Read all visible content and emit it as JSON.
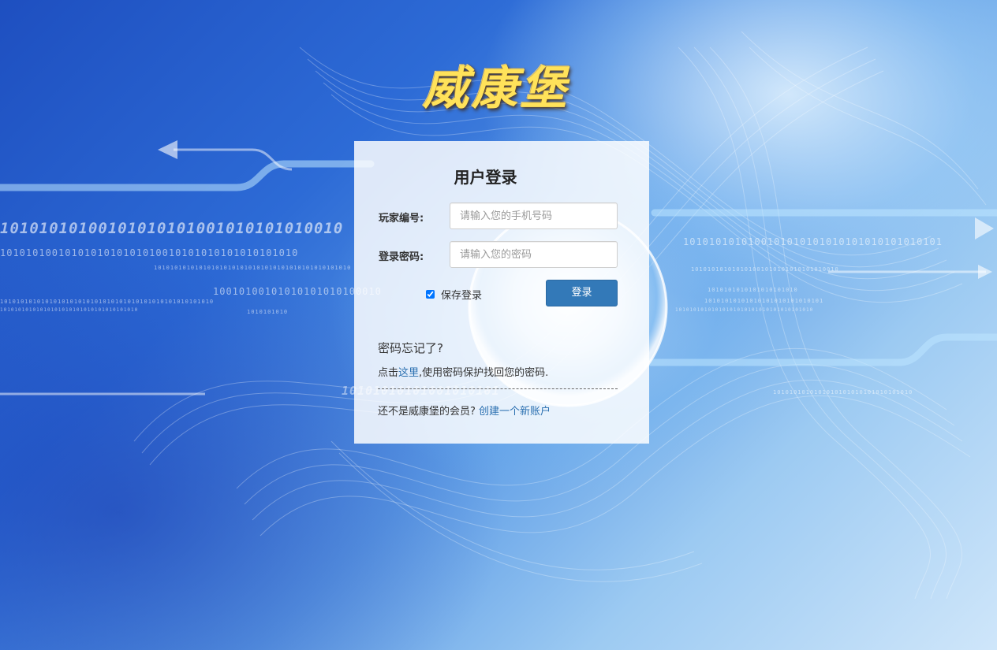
{
  "logo": {
    "text": "威康堡"
  },
  "binary_strings": [
    "10101010100101010101001010101010010",
    "1010101001010101010101010010101010101010101010",
    "101010101010101010101010101010101010101010101010",
    "10010100101010101010100010",
    "1010101010101010101010101010101010101010101010101010",
    "10101010101010101010101010101010101010",
    "1010101010",
    "1010101010100101010101010101010101010101",
    "101010101010101001010101010101010010",
    "1010101010101010101010",
    "10101010101010101010101010101",
    "10101010101010101010101010101010101010",
    "10101010101001010101",
    "1010101010101010101010101010101010"
  ],
  "login": {
    "title": "用户登录",
    "username_label": "玩家编号:",
    "username_placeholder": "请输入您的手机号码",
    "password_label": "登录密码:",
    "password_placeholder": "请输入您的密码",
    "remember_label": "保存登录",
    "remember_checked": true,
    "submit_label": "登录",
    "accent_color": "#3379b8"
  },
  "forgot": {
    "title": "密码忘记了?",
    "prefix": "点击",
    "link": "这里",
    "suffix": ",使用密码保护找回您的密码."
  },
  "register": {
    "prefix": "还不是威康堡的会员? ",
    "link": "创建一个新账户"
  }
}
